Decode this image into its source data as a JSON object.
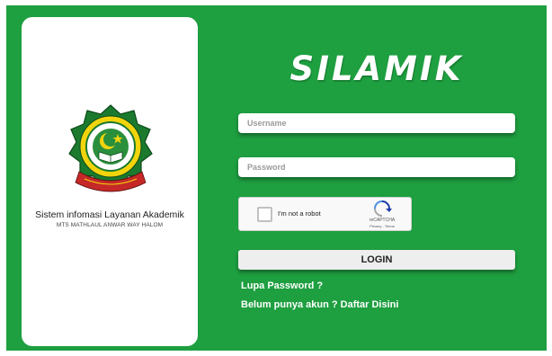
{
  "left_panel": {
    "app_name": "Sistem infomasi Layanan Akademik",
    "school_name": "MTS MATHLAUL ANWAR WAY HALOM",
    "logo_icon": "school-emblem-icon"
  },
  "brand": {
    "title": "SILAMIK"
  },
  "form": {
    "username_placeholder": "Username",
    "username_value": "",
    "password_placeholder": "Password",
    "password_value": "",
    "captcha": {
      "label": "I'm not a robot",
      "brand": "reCAPTCHA",
      "terms": "Privacy - Terms",
      "checked": false
    },
    "login_label": "LOGIN"
  },
  "links": {
    "forgot": "Lupa Password ?",
    "register": "Belum punya akun ? Daftar Disini"
  },
  "colors": {
    "background": "#1e9f40",
    "card": "#ffffff",
    "button": "#eeeeee",
    "link": "#ffffff"
  }
}
